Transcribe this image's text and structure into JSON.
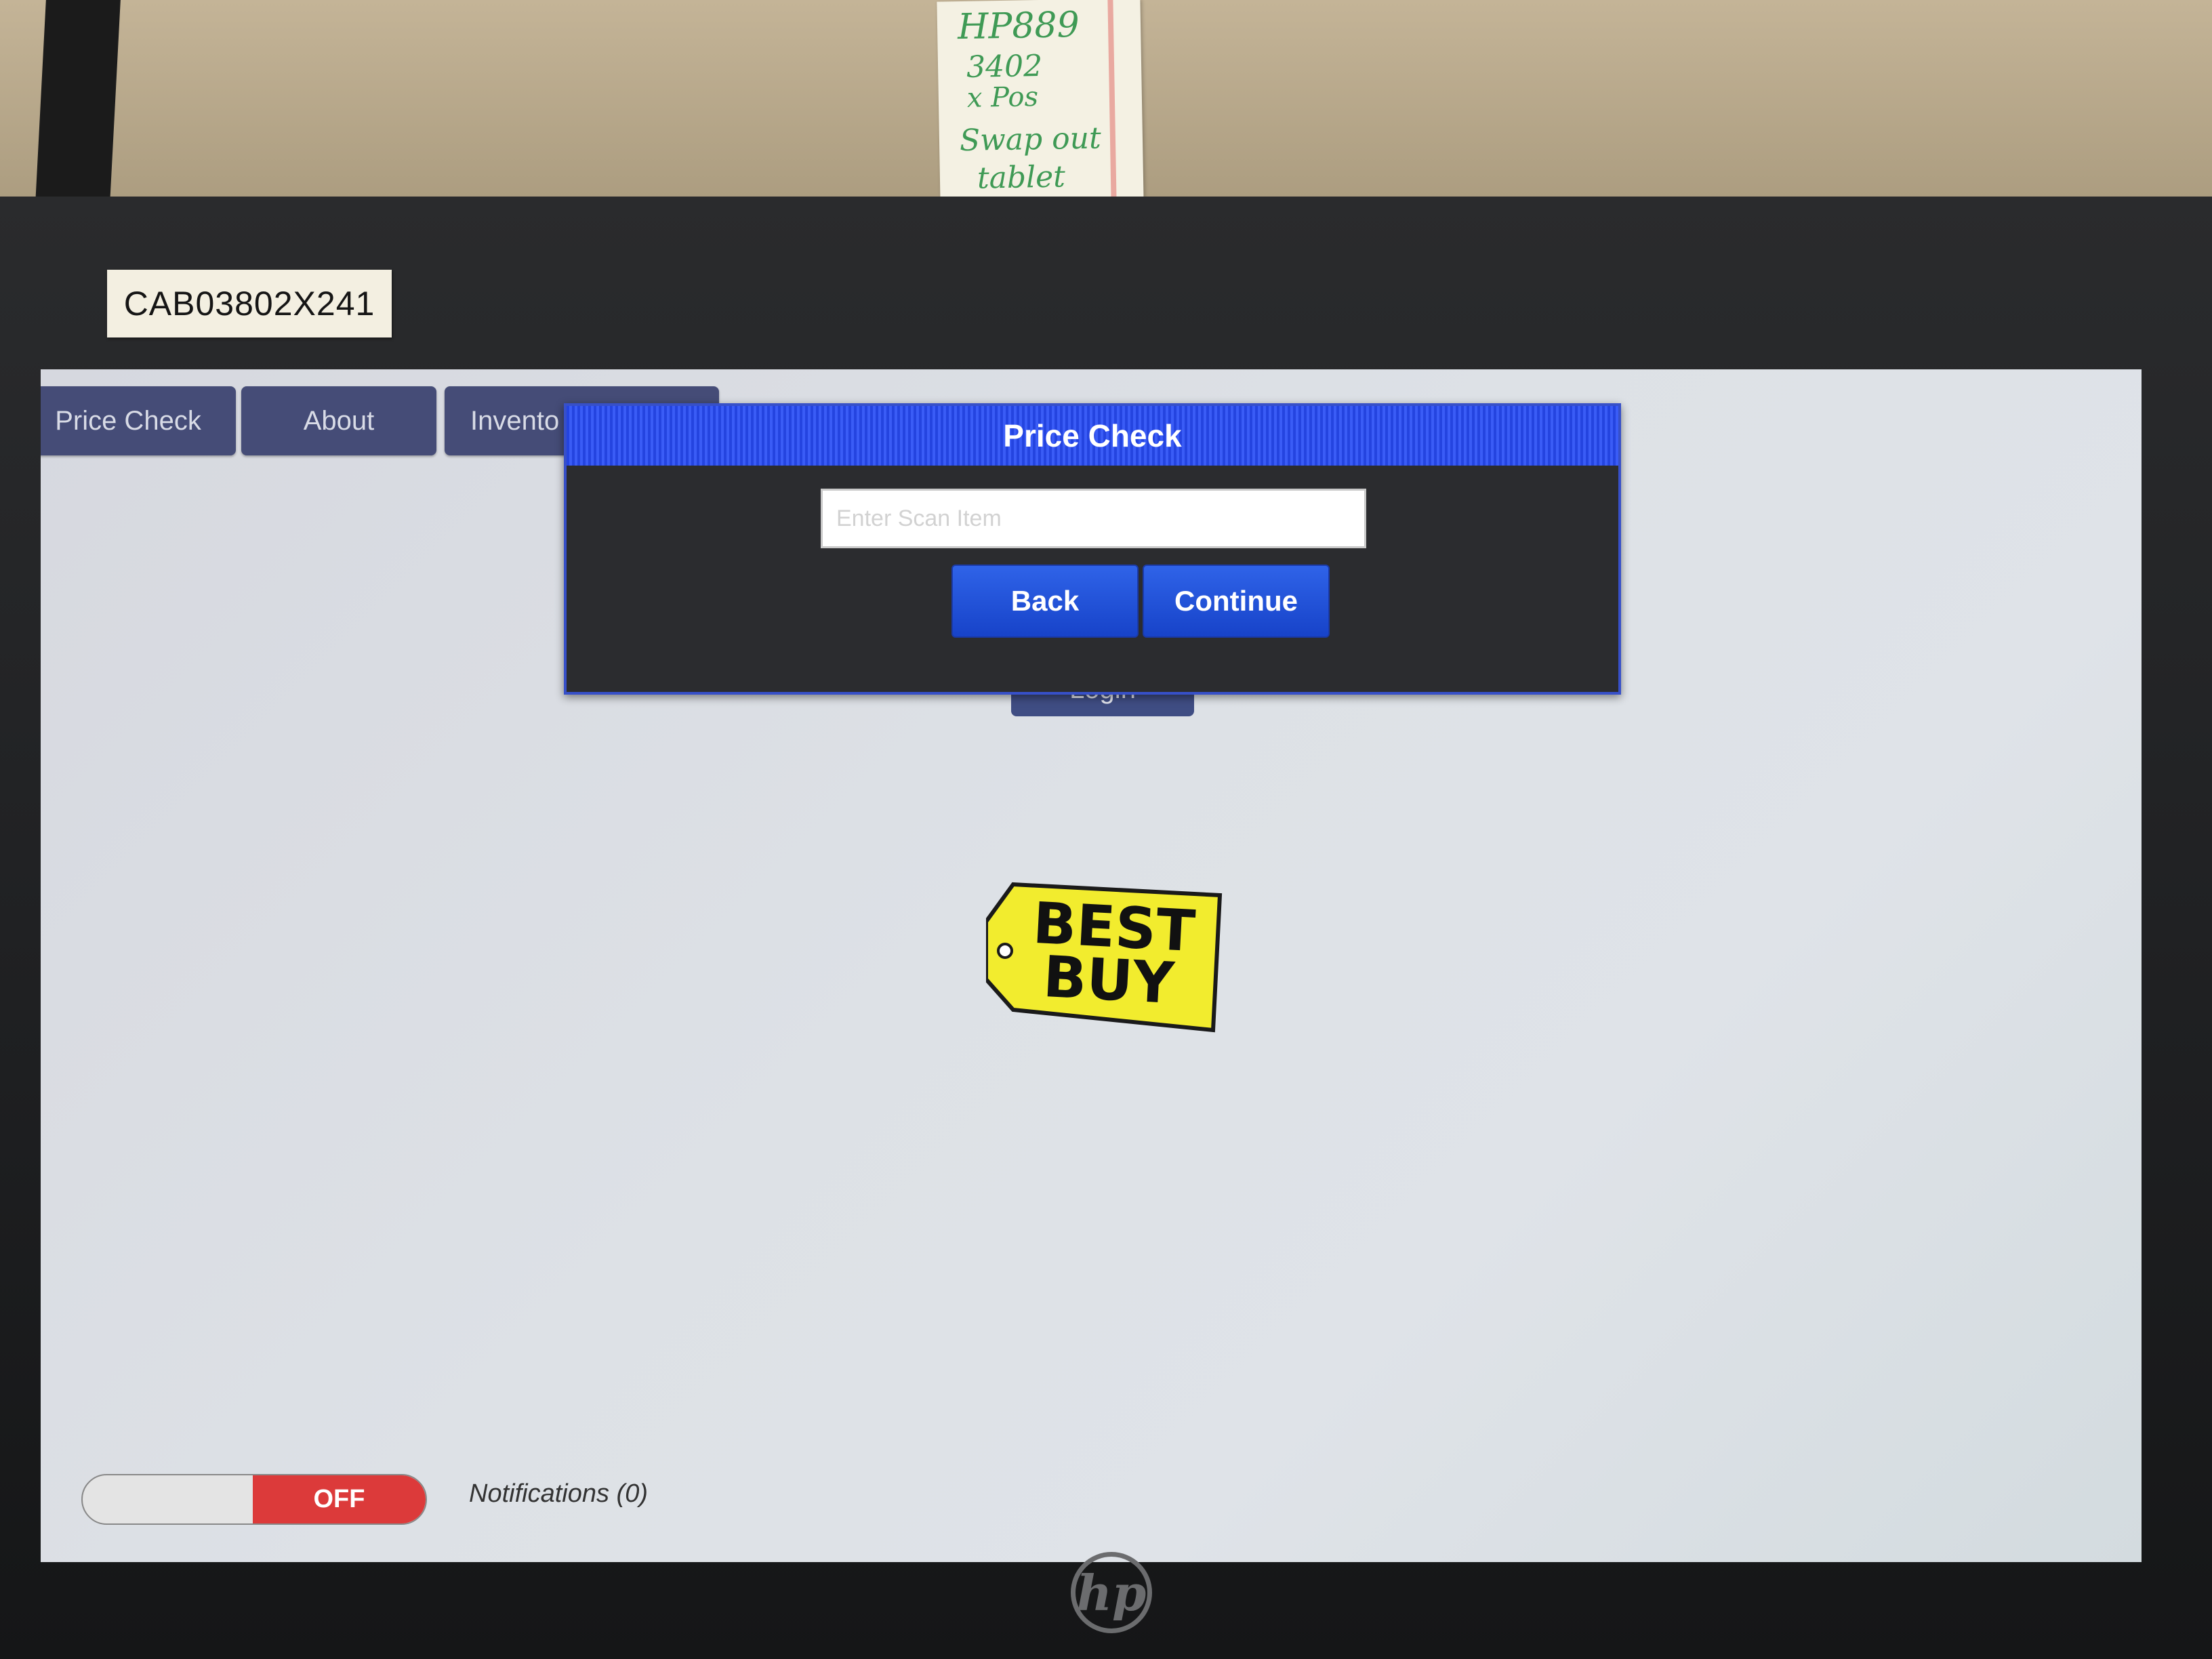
{
  "background": {
    "sticky_note_lines": [
      "HP889",
      "3402",
      "x Pos",
      "Swap out",
      "tablet"
    ],
    "asset_tag": "CAB03802X241",
    "monitor_brand_icon": "hp-logo"
  },
  "nav": {
    "tabs": [
      {
        "label": "Price Check"
      },
      {
        "label": "About"
      },
      {
        "label": "Invento"
      }
    ]
  },
  "modal": {
    "title": "Price Check",
    "input_placeholder": "Enter Scan Item",
    "input_value": "",
    "back_label": "Back",
    "continue_label": "Continue",
    "accent_color": "#2f55e8"
  },
  "main": {
    "login_label": "Login",
    "logo": {
      "line1": "BEST",
      "line2": "BUY",
      "color": "#f2ec2e"
    }
  },
  "footer": {
    "toggle_state": "OFF",
    "notifications_text": "Notifications (0)",
    "toggle_off_color": "#dc3a3a"
  }
}
